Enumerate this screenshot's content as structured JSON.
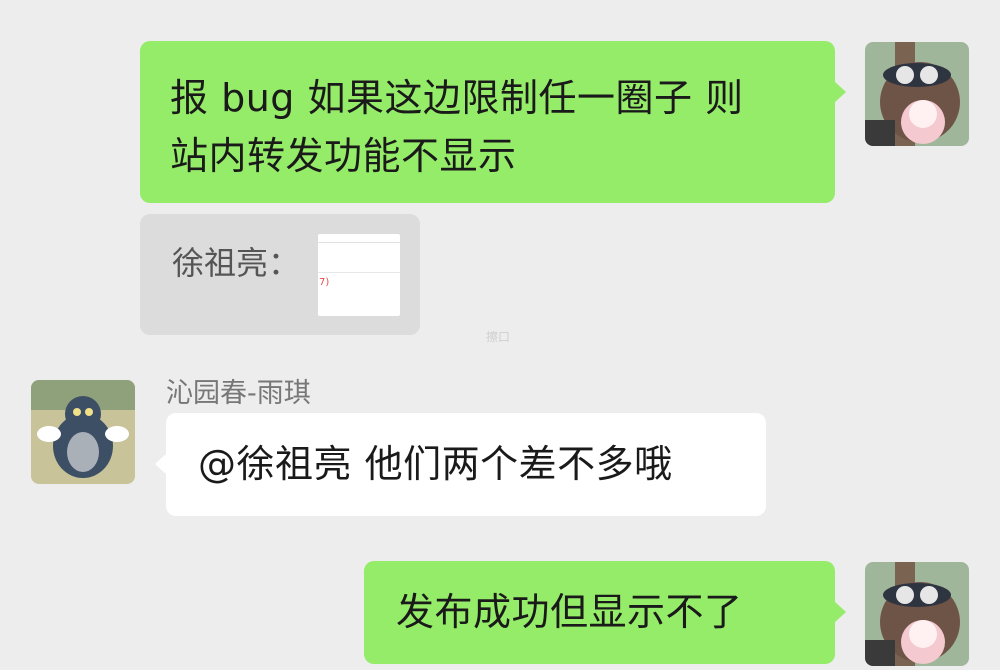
{
  "messages": [
    {
      "side": "right",
      "text_line1": "报 bug 如果这边限制任一圈子 则",
      "text_line2": "站内转发功能不显示"
    },
    {
      "side": "right",
      "quote_prefix": "徐祖亮："
    },
    {
      "side": "left",
      "sender": "沁园春-雨琪",
      "text": "@徐祖亮 他们两个差不多哦"
    },
    {
      "side": "right",
      "text": "发布成功但显示不了"
    }
  ],
  "faint_label": "擦口",
  "thumbnail_red_text": "7)",
  "colors": {
    "background": "#ededed",
    "my_bubble": "#95ec69",
    "other_bubble": "#ffffff",
    "quote_bubble": "#dcdcdc"
  },
  "avatars": {
    "self": "bear-avatar-icon",
    "other": "cat-avatar-icon"
  }
}
